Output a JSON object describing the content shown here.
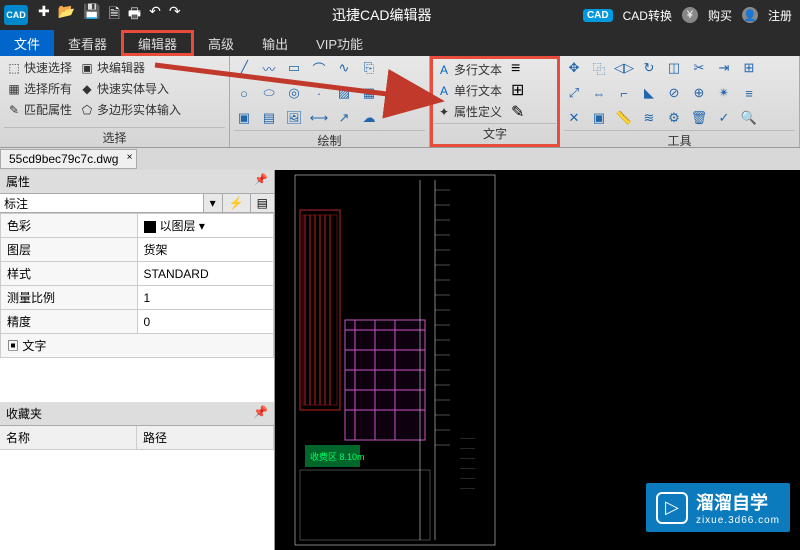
{
  "titlebar": {
    "logo": "CAD",
    "title": "迅捷CAD编辑器",
    "cad_badge": "CAD",
    "convert": "CAD转换",
    "buy": "购买",
    "register": "注册"
  },
  "menu": {
    "file": "文件",
    "viewer": "查看器",
    "editor": "编辑器",
    "advanced": "高级",
    "output": "输出",
    "vip": "VIP功能"
  },
  "ribbon": {
    "select": {
      "quick_select": "快速选择",
      "select_all": "选择所有",
      "match_prop": "匹配属性",
      "block_editor": "块编辑器",
      "quick_solid_import": "快速实体导入",
      "poly_solid_input": "多边形实体输入",
      "label": "选择"
    },
    "draw": {
      "label": "绘制"
    },
    "text": {
      "multiline": "多行文本",
      "singleline": "单行文本",
      "attr_def": "属性定义",
      "label": "文字"
    },
    "tools": {
      "label": "工具"
    }
  },
  "doc": {
    "filename": "55cd9bec79c7c.dwg"
  },
  "props": {
    "title": "属性",
    "combo_value": "标注",
    "rows": {
      "color": "色彩",
      "color_val": "以图层",
      "layer": "图层",
      "layer_val": "货架",
      "style": "样式",
      "style_val": "STANDARD",
      "scale": "测量比例",
      "scale_val": "1",
      "precision": "精度",
      "precision_val": "0",
      "text_cat": "文字"
    }
  },
  "fav": {
    "title": "收藏夹",
    "col_name": "名称",
    "col_path": "路径"
  },
  "watermark": {
    "main": "溜溜自学",
    "sub": "zixue.3d66.com"
  }
}
